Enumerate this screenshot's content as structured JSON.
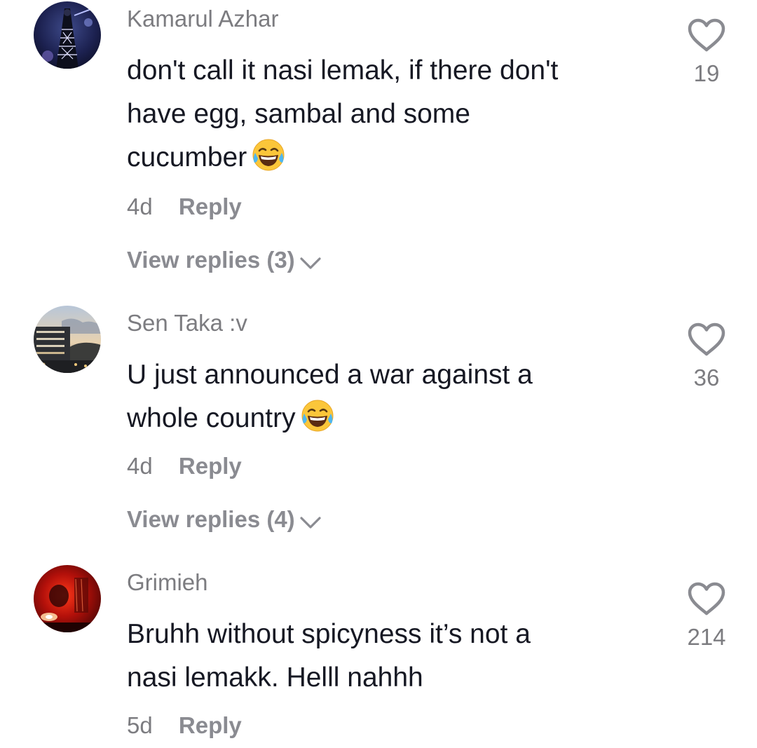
{
  "comments": [
    {
      "username": "Kamarul Azhar",
      "text_lines": [
        "don't call it nasi lemak, if there don't",
        "have egg, sambal and some",
        "cucumber"
      ],
      "emoji": "face-with-tears-of-joy",
      "time": "4d",
      "reply_label": "Reply",
      "view_replies": "View replies (3)",
      "likes": "19"
    },
    {
      "username": "Sen Taka :v",
      "text_lines": [
        "U just announced a war against a",
        "whole country"
      ],
      "emoji": "face-with-tears-of-joy",
      "time": "4d",
      "reply_label": "Reply",
      "view_replies": "View replies (4)",
      "likes": "36"
    },
    {
      "username": "Grimieh",
      "text_lines": [
        "Bruhh without spicyness it’s not a",
        "nasi lemakk. Helll nahhh"
      ],
      "time": "5d",
      "reply_label": "Reply",
      "likes": "214"
    }
  ],
  "icons": {
    "like": "heart-outline-icon",
    "expand": "chevron-down-icon",
    "emoji": "face-with-tears-of-joy-emoji"
  },
  "colors": {
    "text": "#161823",
    "muted": "#7c7c80",
    "reply": "#8a8b91"
  }
}
